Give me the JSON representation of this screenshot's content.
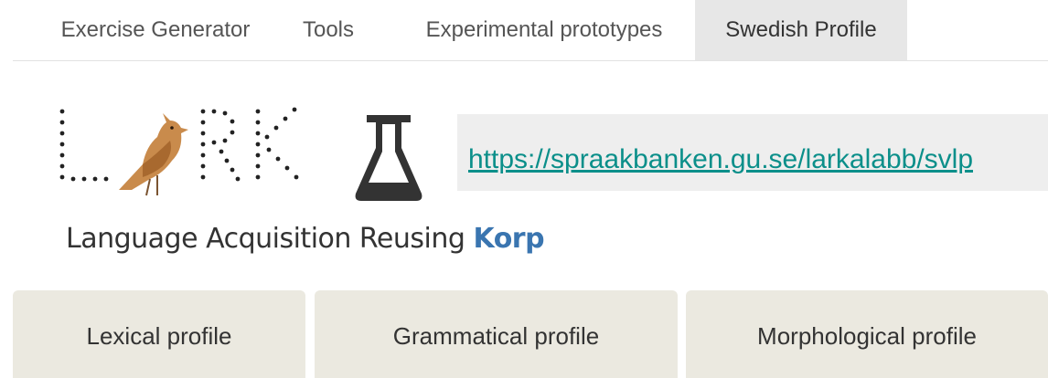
{
  "nav": {
    "tabs": [
      {
        "label": "Exercise Generator"
      },
      {
        "label": "Tools"
      },
      {
        "label": "Experimental prototypes"
      },
      {
        "label": "Swedish Profile",
        "active": true
      }
    ]
  },
  "header": {
    "logo_text": "LARK",
    "link": "https://spraakbanken.gu.se/larkalabb/svlp",
    "tagline_prefix": "Language Acquisition Reusing ",
    "tagline_accent": "Korp"
  },
  "profiles": [
    {
      "label": "Lexical profile"
    },
    {
      "label": "Grammatical profile"
    },
    {
      "label": "Morphological profile"
    }
  ],
  "colors": {
    "link": "#0b8f8a",
    "accent": "#3a75b0",
    "profile_bg": "#ebe9e0",
    "active_tab_bg": "#e7e7e7"
  }
}
